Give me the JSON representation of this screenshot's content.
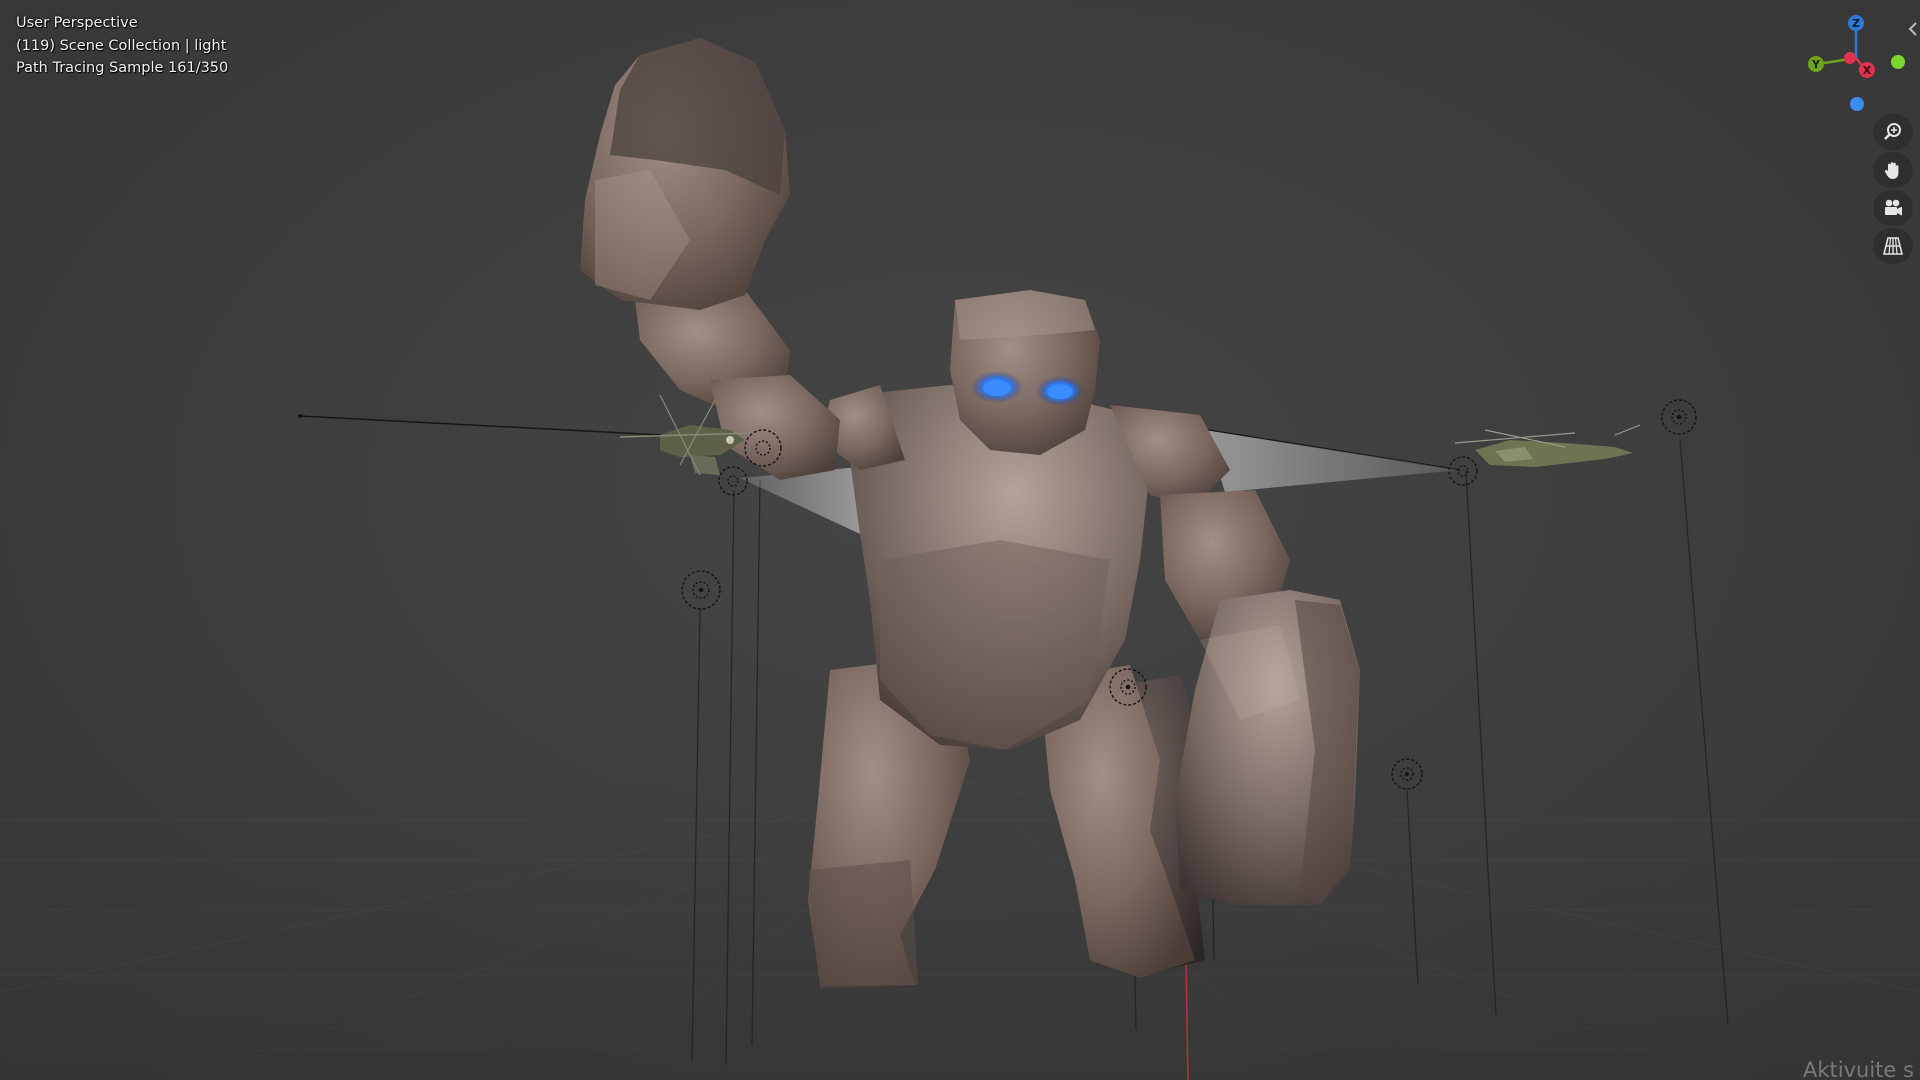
{
  "viewport": {
    "info_lines": [
      "User Perspective",
      "(119) Scene Collection | light",
      "Path Tracing Sample 161/350"
    ]
  },
  "gizmo": {
    "z_label": "Z",
    "y_label": "Y",
    "x_label": "X",
    "colors": {
      "x": "#e0344e",
      "y": "#6fa51c",
      "z": "#2f79d6",
      "neg_y": "#7bd52f",
      "neg_z": "#3a8ef0"
    }
  },
  "nav_buttons": [
    {
      "name": "zoom-icon"
    },
    {
      "name": "pan-hand-icon"
    },
    {
      "name": "camera-view-icon"
    },
    {
      "name": "perspective-grid-icon"
    }
  ],
  "watermark": {
    "text": "Aktivuite s"
  },
  "colors": {
    "background": "#3d3d3d",
    "eye_glow": "#2a7dff",
    "rock": "#7a6a62"
  }
}
